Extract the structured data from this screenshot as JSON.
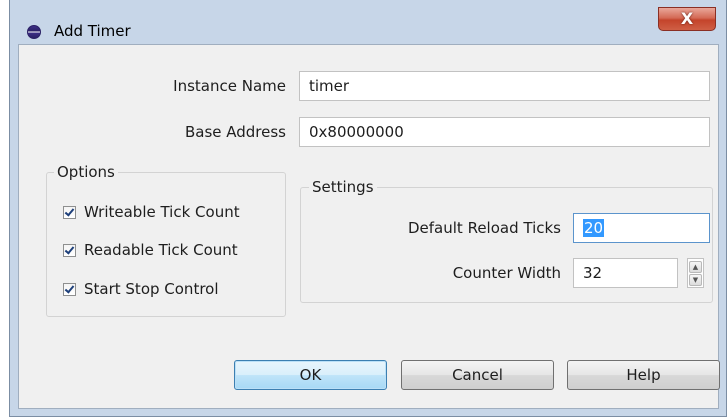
{
  "window": {
    "title": "Add Timer",
    "close_glyph": "X",
    "app_icon": "eclipse-icon"
  },
  "form": {
    "instance_name": {
      "label": "Instance Name",
      "value": "timer"
    },
    "base_address": {
      "label": "Base Address",
      "value": "0x80000000"
    }
  },
  "options": {
    "legend": "Options",
    "items": [
      {
        "label": "Writeable Tick Count",
        "checked": true
      },
      {
        "label": "Readable Tick Count",
        "checked": true
      },
      {
        "label": "Start Stop Control",
        "checked": true
      }
    ]
  },
  "settings": {
    "legend": "Settings",
    "default_reload_ticks": {
      "label": "Default Reload Ticks",
      "value": "20"
    },
    "counter_width": {
      "label": "Counter Width",
      "value": "32"
    }
  },
  "buttons": {
    "ok": "OK",
    "cancel": "Cancel",
    "help": "Help"
  },
  "colors": {
    "frame": "#c7d6e8",
    "client": "#f0f0f0",
    "close_button": "#c4442b",
    "selection": "#3399ff",
    "default_button_border": "#3c7fb1"
  }
}
